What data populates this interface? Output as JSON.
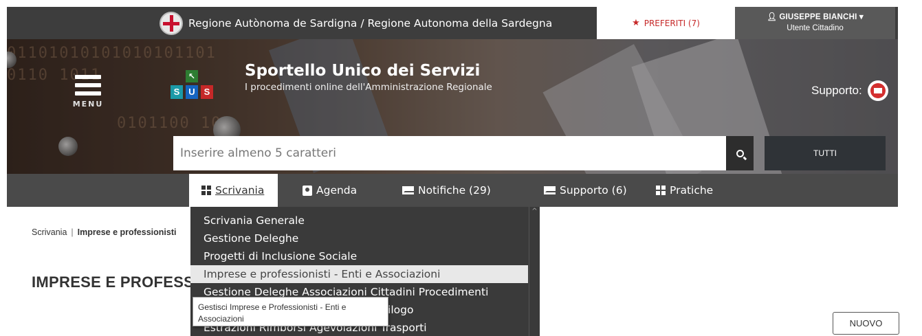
{
  "topbar": {
    "region_title": "Regione Autònoma de Sardigna / Regione Autonoma della Sardegna",
    "favorites_label": "PREFERITI (7)",
    "user_name": "GIUSEPPE BIANCHI",
    "user_role": "Utente Cittadino",
    "accent_red": "#c62828"
  },
  "header": {
    "menu_label": "MENU",
    "app_title": "Sportello Unico dei Servizi",
    "app_subtitle": "I procedimenti online dell'Amministrazione Regionale",
    "logo_letters": [
      "S",
      "U",
      "S"
    ],
    "support_label": "Supporto:"
  },
  "search": {
    "placeholder": "Inserire almeno 5 caratteri",
    "filter_label": "TUTTI"
  },
  "nav": {
    "items": [
      {
        "label": "Scrivania",
        "icon": "grid-icon",
        "active": true
      },
      {
        "label": "Agenda",
        "icon": "agenda-icon"
      },
      {
        "label": "Notifiche (29)",
        "icon": "envelope-icon"
      },
      {
        "label": "Supporto (6)",
        "icon": "envelope-icon"
      },
      {
        "label": "Pratiche",
        "icon": "grid-icon"
      }
    ]
  },
  "dropdown": {
    "items": [
      "Scrivania Generale",
      "Gestione Deleghe",
      "Progetti di Inclusione Sociale",
      "Imprese e professionisti - Enti e Associazioni",
      "Gestione Deleghe Associazioni Cittadini Procedimenti",
      "Gestione attività subacquea - Riepilogo",
      "Estrazioni Rimborsi Agevolazioni Trasporti"
    ],
    "highlighted_index": 3
  },
  "tooltip": {
    "text": "Gestisci Imprese e Professionisti - Enti e Associazioni"
  },
  "breadcrumb": {
    "root": "Scrivania",
    "separator": "|",
    "current": "Imprese e professionisti"
  },
  "page": {
    "title": "IMPRESE E PROFESSIONISTI",
    "new_button": "NUOVO"
  }
}
